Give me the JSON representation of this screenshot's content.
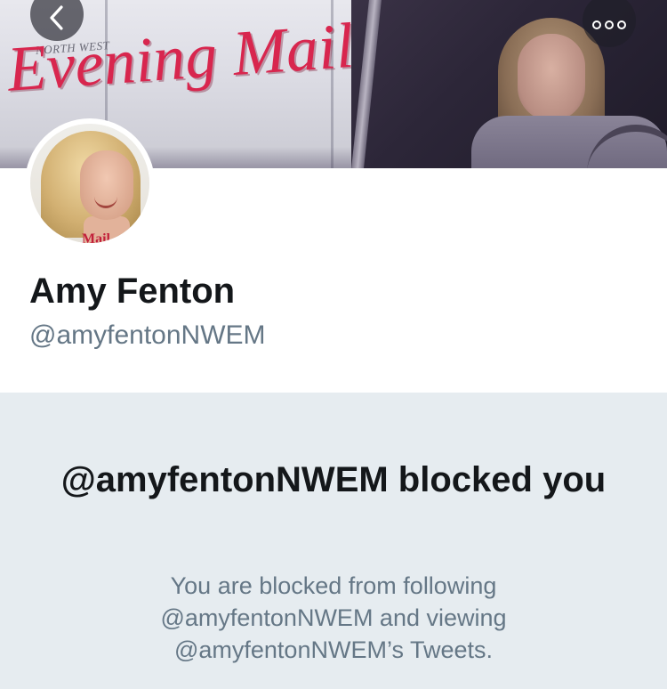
{
  "banner": {
    "brand_small": "NORTH WEST",
    "brand_big": "Evening Mail"
  },
  "header": {
    "back_icon": "chevron-left-icon",
    "more_icon": "more-options-icon"
  },
  "avatar": {
    "logo_text": "Mail"
  },
  "profile": {
    "display_name": "Amy Fenton",
    "handle": "@amyfentonNWEM"
  },
  "blocked": {
    "title": "@amyfentonNWEM blocked you",
    "description": "You are blocked from following @amyfentonNWEM and viewing @amyfentonNWEM’s Tweets."
  },
  "colors": {
    "blocked_background": "#e6ecf0",
    "primary_text": "#14171a",
    "secondary_text": "#657786",
    "brand_red": "#d8264e"
  }
}
